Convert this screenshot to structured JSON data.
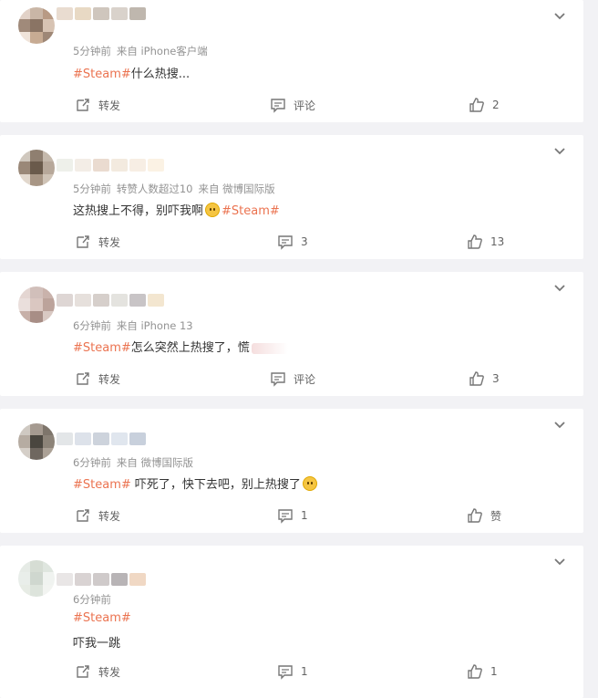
{
  "posts": [
    {
      "time": "5分钟前",
      "source": "来自 iPhone客户端",
      "topic": "#Steam#",
      "text": "什么热搜...",
      "repost_label": "转发",
      "comment_label": "评论",
      "like_count": "2",
      "avatar_colors": [
        "#e2d2c8",
        "#c9b6a6",
        "#b89a84",
        "#a08a7a",
        "#8a7464",
        "#d7c3b3",
        "#f0e4da",
        "#c7ab93",
        "#9e8776"
      ],
      "name_colors": [
        "#e9dcd0",
        "#e8d9c4",
        "#cfc6bd",
        "#d9d2cb",
        "#bfb7ae"
      ]
    },
    {
      "time": "5分钟前",
      "forwards": "转赞人数超过10",
      "source": "来自 微博国际版",
      "text": "这热搜上不得，别吓我啊",
      "topic": "#Steam#",
      "repost_label": "转发",
      "comment_count": "3",
      "like_count": "13",
      "avatar_colors": [
        "#d0c8be",
        "#8f7f70",
        "#c5b9ac",
        "#9a8878",
        "#6a5a4b",
        "#b7a89a",
        "#e2d8cd",
        "#a89685",
        "#cfc3b6"
      ],
      "name_colors": [
        "#eef0ea",
        "#f3ede6",
        "#eadbd0",
        "#f3eadf",
        "#f7eee4",
        "#fbf2e4"
      ]
    },
    {
      "time": "6分钟前",
      "source": "来自 iPhone 13",
      "topic": "#Steam#",
      "text": "怎么突然上热搜了，慌",
      "repost_label": "转发",
      "comment_label": "评论",
      "like_count": "3",
      "avatar_colors": [
        "#e4d6d2",
        "#d1bfba",
        "#c9b2ab",
        "#eadfdc",
        "#dac7c1",
        "#bca39b",
        "#c7b0a8",
        "#a88e86",
        "#d9c9c3"
      ],
      "name_colors": [
        "#ded6d4",
        "#e6e0dc",
        "#d6cfcb",
        "#e4e3df",
        "#c8c4c6",
        "#f3e6d0"
      ]
    },
    {
      "time": "6分钟前",
      "source": "来自 微博国际版",
      "topic": "#Steam#",
      "text": " 吓死了，快下去吧，别上热搜了",
      "repost_label": "转发",
      "comment_count": "1",
      "like_label": "赞",
      "avatar_colors": [
        "#cfc9c2",
        "#a59a90",
        "#7e756b",
        "#b6aca2",
        "#4a463f",
        "#8c8378",
        "#d5cfc8",
        "#6f675f",
        "#aba196"
      ],
      "name_colors": [
        "#e3e6e8",
        "#dde2ea",
        "#cdd3dc",
        "#e0e6ee",
        "#c8d0dc"
      ]
    },
    {
      "time": "6分钟前",
      "topic": "#Steam#",
      "text": "吓我一跳",
      "repost_label": "转发",
      "comment_count": "1",
      "like_count": "1",
      "avatar_colors": [
        "#e6ebe6",
        "#d6ddd4",
        "#dfe6df",
        "#e9eeea",
        "#cfd7cf",
        "#f0f3f0",
        "#e7ece5",
        "#dde4dc",
        "#f2f4f1"
      ],
      "name_colors": [
        "#e9e6e6",
        "#d9d3d3",
        "#cfcaca",
        "#b8b4b6",
        "#f0d8c4"
      ]
    }
  ]
}
